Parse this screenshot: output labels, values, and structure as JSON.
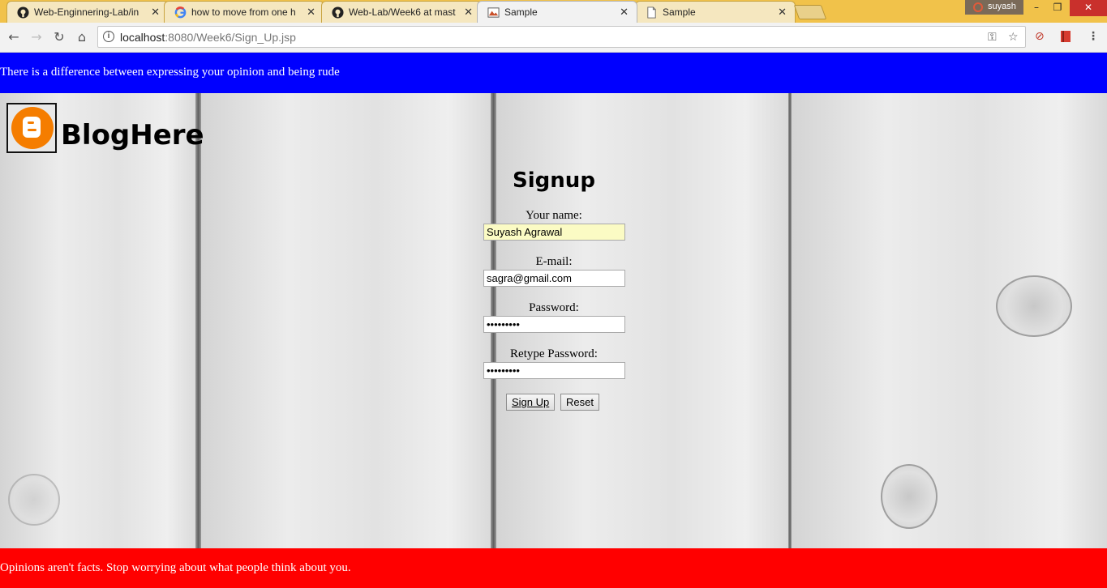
{
  "browser": {
    "tabs": [
      {
        "title": "Web-Enginnering-Lab/in",
        "icon": "github-icon"
      },
      {
        "title": "how to move from one h",
        "icon": "google-icon"
      },
      {
        "title": "Web-Lab/Week6 at mast",
        "icon": "github-icon"
      },
      {
        "title": "Sample",
        "icon": "page-image-icon"
      },
      {
        "title": "Sample",
        "icon": "document-icon"
      }
    ],
    "tab_close": "✕",
    "profile_name": "suyash",
    "url_host": "localhost",
    "url_path": ":8080/Week6/Sign_Up.jsp"
  },
  "page": {
    "top_banner": "There is a difference between expressing your opinion and being rude",
    "top_banner_color": "#0000ff",
    "brand": "BlogHere",
    "form": {
      "title": "Signup",
      "name_label": "Your name:",
      "name_value": "Suyash Agrawal",
      "email_label": "E-mail:",
      "email_value": "sagra@gmail.com",
      "password_label": "Password:",
      "password_value": "•••••••••",
      "retype_label": "Retype Password:",
      "retype_value": "•••••••••",
      "signup_button": "Sign Up",
      "reset_button": "Reset"
    },
    "bottom_banner": "Opinions aren't facts. Stop worrying about what people think about you.",
    "bottom_banner_color": "#ff0000"
  }
}
